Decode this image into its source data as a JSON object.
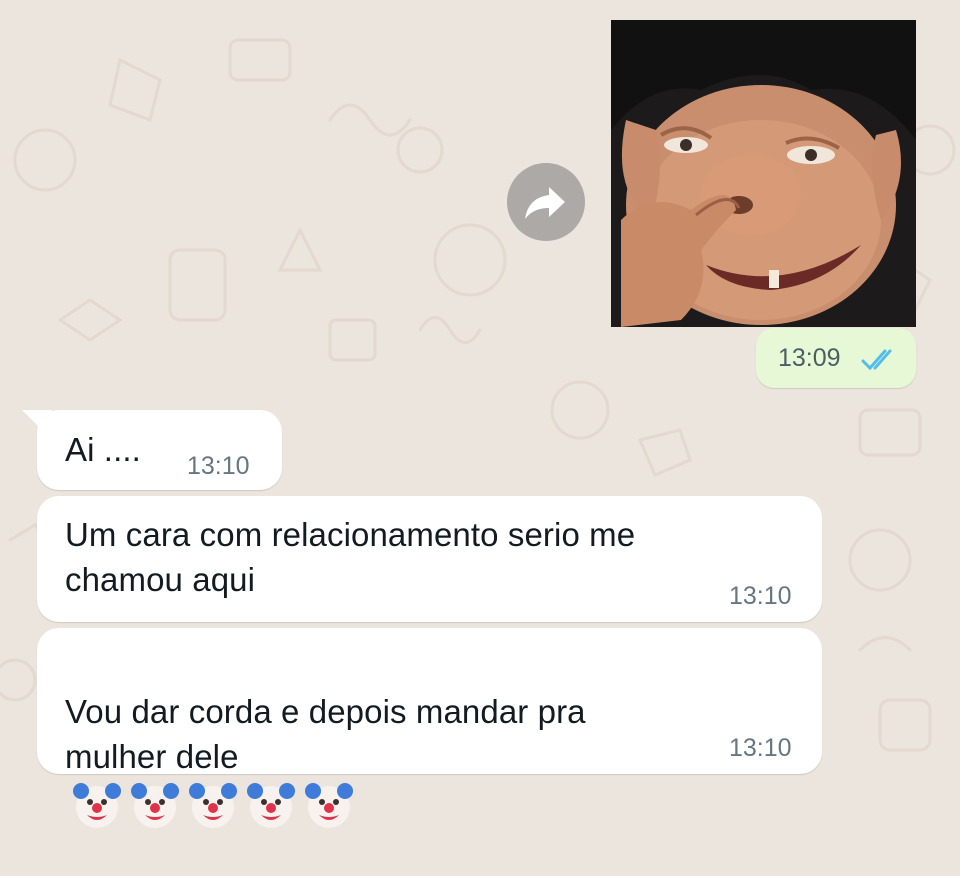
{
  "outgoing": {
    "media_description_icon": "goblin-sticker-image",
    "forward_icon": "forward-arrow-icon",
    "time": "13:09",
    "status_icon": "double-check-blue-icon",
    "status_color": "#53bdeb"
  },
  "incoming": [
    {
      "text": "Ai ....",
      "time": "13:10"
    },
    {
      "text": "Um cara com relacionamento serio me\nchamou aqui",
      "time": "13:10"
    },
    {
      "text": "Vou dar corda e depois mandar pra\nmulher dele",
      "time": "13:10",
      "emoji": [
        "clown-face",
        "clown-face",
        "clown-face",
        "clown-face",
        "clown-face"
      ]
    }
  ],
  "colors": {
    "wallpaper": "#ece5dd",
    "outgoing_bubble": "#e7f8d6",
    "incoming_bubble": "#ffffff",
    "timestamp": "#667781"
  }
}
